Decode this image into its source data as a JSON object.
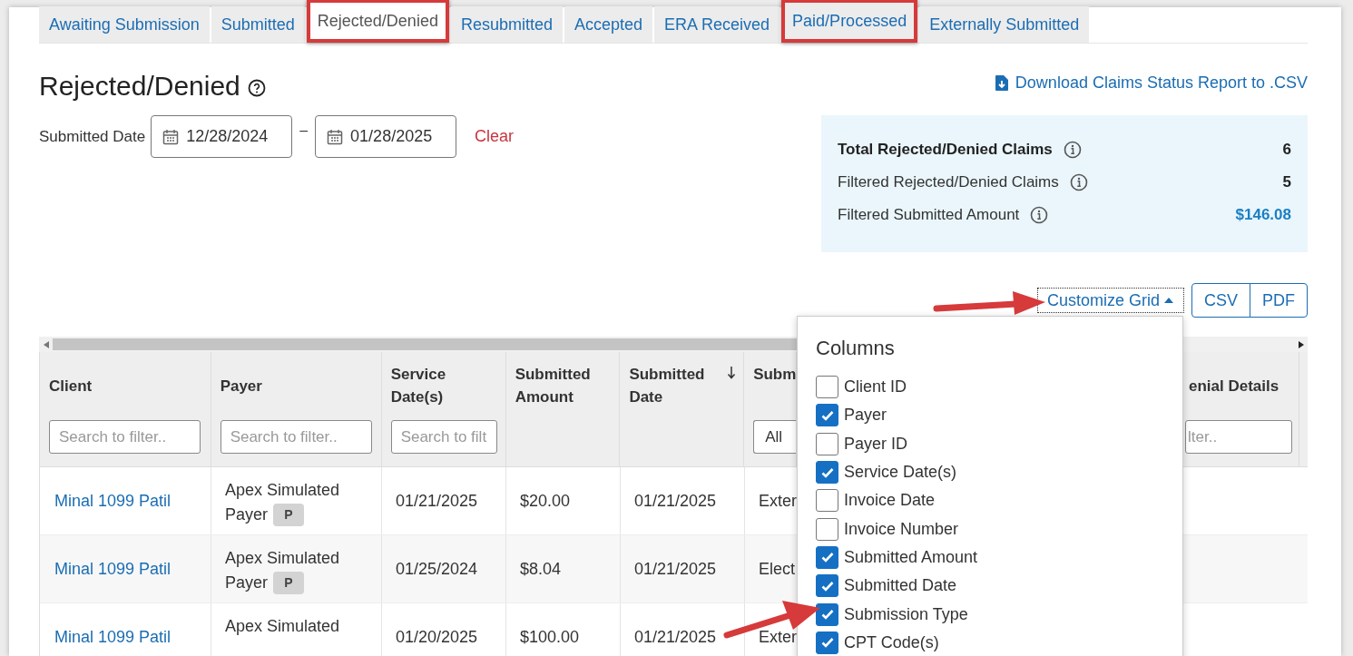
{
  "tabs": [
    {
      "label": "Awaiting Submission",
      "selected": false,
      "highlighted": false
    },
    {
      "label": "Submitted",
      "selected": false,
      "highlighted": false
    },
    {
      "label": "Rejected/Denied",
      "selected": true,
      "highlighted": true
    },
    {
      "label": "Resubmitted",
      "selected": false,
      "highlighted": false
    },
    {
      "label": "Accepted",
      "selected": false,
      "highlighted": false
    },
    {
      "label": "ERA Received",
      "selected": false,
      "highlighted": false
    },
    {
      "label": "Paid/Processed",
      "selected": false,
      "highlighted": true
    },
    {
      "label": "Externally Submitted",
      "selected": false,
      "highlighted": false
    }
  ],
  "heading": "Rejected/Denied",
  "download_link": "Download Claims Status Report to .CSV",
  "date_filter": {
    "label": "Submitted Date",
    "from": "12/28/2024",
    "separator": "–",
    "to": "01/28/2025",
    "clear": "Clear"
  },
  "summary": [
    {
      "label": "Total Rejected/Denied Claims",
      "value": "6",
      "kind": "total"
    },
    {
      "label": "Filtered Rejected/Denied Claims",
      "value": "5",
      "kind": "count"
    },
    {
      "label": "Filtered Submitted Amount",
      "value": "$146.08",
      "kind": "amount"
    }
  ],
  "customize_button": {
    "label": "Customize Grid",
    "expanded": true
  },
  "export_buttons": [
    "CSV",
    "PDF"
  ],
  "table": {
    "columns": [
      {
        "label": "Client",
        "filter": {
          "kind": "text",
          "placeholder": "Search to filter.."
        }
      },
      {
        "label": "Payer",
        "filter": {
          "kind": "text",
          "placeholder": "Search to filter.."
        }
      },
      {
        "label": "Service Date(s)",
        "filter": {
          "kind": "text",
          "placeholder": "Search to filt"
        }
      },
      {
        "label": "Submitted Amount"
      },
      {
        "label": "Submitted Date",
        "sorted": true
      },
      {
        "label": "Subm",
        "filter": {
          "kind": "select",
          "value": "All"
        }
      },
      {
        "label": "enial Details",
        "filter": {
          "kind": "text",
          "placeholder": "lter.."
        }
      }
    ],
    "rows": [
      {
        "client": "Minal 1099 Patil",
        "payer_lines": [
          "Apex Simulated",
          "Payer"
        ],
        "payer_badge": "P",
        "service_date": "01/21/2025",
        "amount": "$20.00",
        "submitted_date": "01/21/2025",
        "column_6": "Exter"
      },
      {
        "client": "Minal 1099 Patil",
        "payer_lines": [
          "Apex Simulated",
          "Payer"
        ],
        "payer_badge": "P",
        "service_date": "01/25/2024",
        "amount": "$8.04",
        "submitted_date": "01/21/2025",
        "column_6": "Elect"
      },
      {
        "client": "Minal 1099 Patil",
        "payer_lines": [
          "Apex Simulated"
        ],
        "service_date": "01/20/2025",
        "amount": "$100.00",
        "submitted_date": "01/21/2025",
        "column_6": "Exter"
      }
    ]
  },
  "columns_menu": {
    "title": "Columns",
    "items": [
      {
        "label": "Client ID",
        "checked": false
      },
      {
        "label": "Payer",
        "checked": true
      },
      {
        "label": "Payer ID",
        "checked": false
      },
      {
        "label": "Service Date(s)",
        "checked": true
      },
      {
        "label": "Invoice Date",
        "checked": false
      },
      {
        "label": "Invoice Number",
        "checked": false
      },
      {
        "label": "Submitted Amount",
        "checked": true
      },
      {
        "label": "Submitted Date",
        "checked": true
      },
      {
        "label": "Submission Type",
        "checked": true
      },
      {
        "label": "CPT Code(s)",
        "checked": true
      }
    ]
  }
}
